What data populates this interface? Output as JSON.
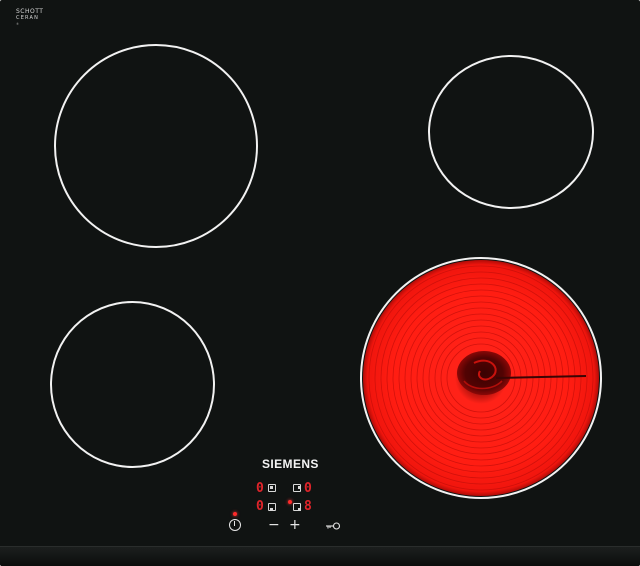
{
  "scene": {
    "description_free": true,
    "glass_marking": {
      "line1": "SCHOTT",
      "line2": "CERAN",
      "line3": "®"
    },
    "brand": "SIEMENS",
    "display": {
      "left_top_digit": "0",
      "left_bottom_digit": "0",
      "right_top_digit": "0",
      "right_bottom_digit": "8"
    },
    "controls": {
      "minus": "−",
      "plus": "+"
    },
    "colors": {
      "glass": "#101312",
      "ring": "#f2f2f2",
      "hot_zone": "#ff1d12",
      "display": "#e0242a"
    },
    "icons": [
      "power-icon",
      "key-lock-icon",
      "zone-selector-icon"
    ]
  }
}
